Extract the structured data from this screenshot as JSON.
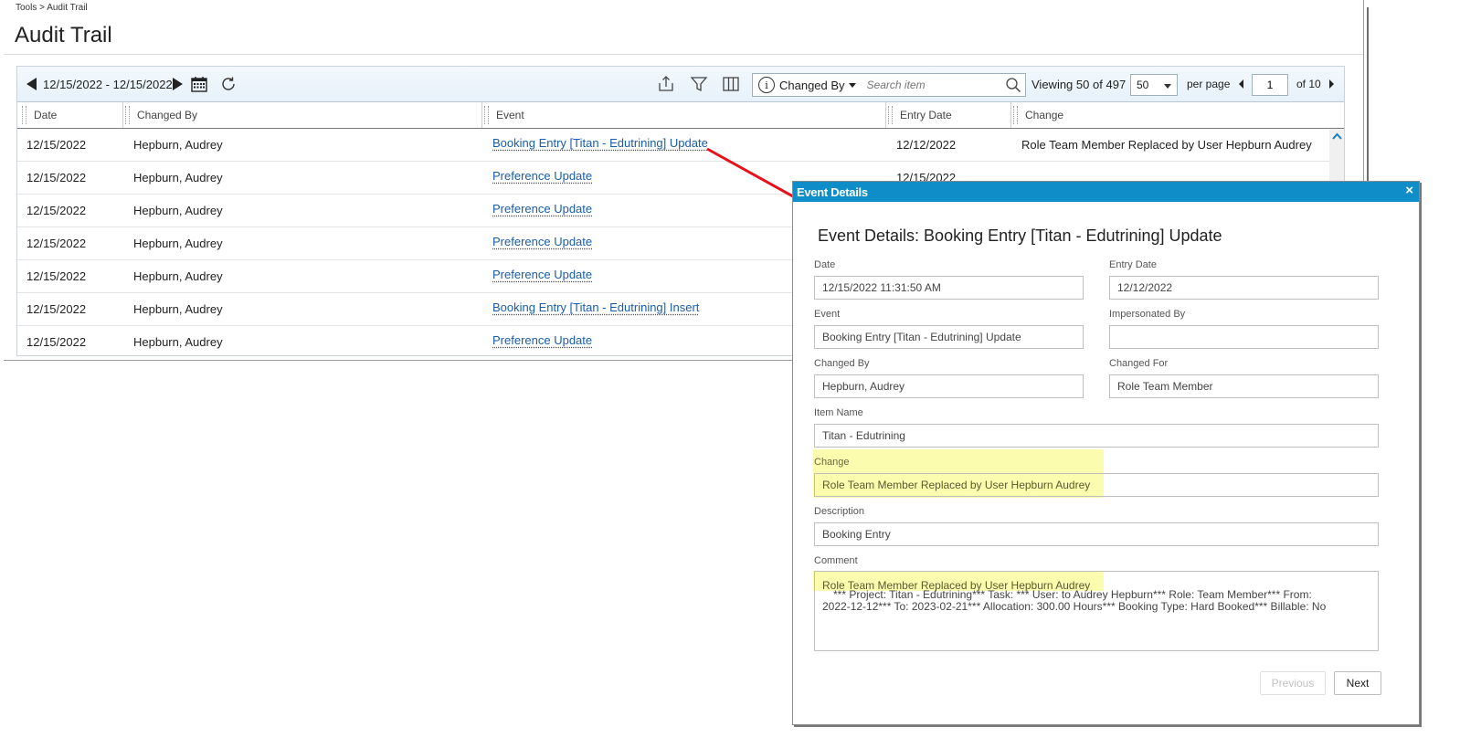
{
  "breadcrumb": "Tools > Audit Trail",
  "page_title": "Audit Trail",
  "toolbar": {
    "date_range": "12/15/2022 - 12/15/2022",
    "filter_field": "Changed By",
    "search_placeholder": "Search item",
    "viewing_label": "Viewing",
    "viewing_count": "50",
    "viewing_of": "of",
    "viewing_total": "497",
    "page_size": "50",
    "per_page_label": "per page",
    "current_page": "1",
    "of_pages": "of 10"
  },
  "columns": [
    "Date",
    "Changed By",
    "Event",
    "Entry Date",
    "Change"
  ],
  "rows": [
    {
      "date": "12/15/2022",
      "changed_by": "Hepburn, Audrey",
      "event": "Booking Entry [Titan - Edutrining] Update",
      "entry_date": "12/12/2022",
      "change": "Role Team Member Replaced by User Hepburn Audrey"
    },
    {
      "date": "12/15/2022",
      "changed_by": "Hepburn, Audrey",
      "event": "Preference Update",
      "entry_date": "12/15/2022",
      "change": ""
    },
    {
      "date": "12/15/2022",
      "changed_by": "Hepburn, Audrey",
      "event": "Preference Update",
      "entry_date": "",
      "change": ""
    },
    {
      "date": "12/15/2022",
      "changed_by": "Hepburn, Audrey",
      "event": "Preference Update",
      "entry_date": "",
      "change": ""
    },
    {
      "date": "12/15/2022",
      "changed_by": "Hepburn, Audrey",
      "event": "Preference Update",
      "entry_date": "",
      "change": ""
    },
    {
      "date": "12/15/2022",
      "changed_by": "Hepburn, Audrey",
      "event": "Booking Entry [Titan - Edutrining] Insert",
      "entry_date": "",
      "change": ""
    },
    {
      "date": "12/15/2022",
      "changed_by": "Hepburn, Audrey",
      "event": "Preference Update",
      "entry_date": "",
      "change": ""
    }
  ],
  "dialog": {
    "titlebar": "Event Details",
    "close_glyph": "×",
    "heading": "Event Details: Booking Entry [Titan - Edutrining] Update",
    "fields": {
      "date_label": "Date",
      "date_value": "12/15/2022 11:31:50 AM",
      "entry_date_label": "Entry Date",
      "entry_date_value": "12/12/2022",
      "event_label": "Event",
      "event_value": "Booking Entry [Titan - Edutrining] Update",
      "impersonated_by_label": "Impersonated By",
      "impersonated_by_value": "",
      "changed_by_label": "Changed By",
      "changed_by_value": "Hepburn, Audrey",
      "changed_for_label": "Changed For",
      "changed_for_value": "Role Team Member",
      "item_name_label": "Item Name",
      "item_name_value": "Titan - Edutrining",
      "change_label": "Change",
      "change_value": "Role Team Member Replaced by User Hepburn Audrey",
      "description_label": "Description",
      "description_value": "Booking Entry",
      "comment_label": "Comment",
      "comment_line1": "Role Team Member Replaced by User Hepburn Audrey",
      "comment_line2": "*** Project: Titan - Edutrining*** Task: *** User:   to Audrey Hepburn*** Role: Team Member*** From:",
      "comment_line3": "2022-12-12*** To: 2023-02-21*** Allocation: 300.00 Hours*** Booking Type: Hard Booked*** Billable:   No"
    },
    "previous_label": "Previous",
    "next_label": "Next"
  },
  "colors": {
    "titlebar": "#0e8dc9",
    "link": "#1a5dab",
    "highlight": "#fbfba0",
    "annotation_arrow": "#e8101a"
  }
}
